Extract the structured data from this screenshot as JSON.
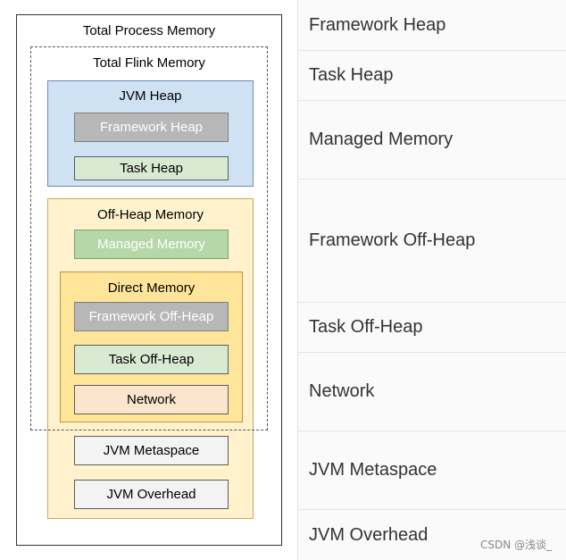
{
  "diagram": {
    "total_process_memory": "Total Process Memory",
    "total_flink_memory": "Total Flink Memory",
    "jvm_heap": {
      "label": "JVM Heap",
      "framework_heap": "Framework Heap",
      "task_heap": "Task Heap"
    },
    "off_heap": {
      "label": "Off-Heap Memory",
      "managed_memory": "Managed Memory",
      "direct": {
        "label": "Direct Memory",
        "framework_off_heap": "Framework Off-Heap",
        "task_off_heap": "Task Off-Heap",
        "network": "Network"
      },
      "jvm_metaspace": "JVM Metaspace",
      "jvm_overhead": "JVM Overhead"
    },
    "colors": {
      "jvm_heap_bg": "#cfe2f3",
      "off_heap_bg": "#fff2cc",
      "direct_memory_bg": "#ffe599",
      "framework_block": "#b7b7b7",
      "task_block": "#d9ead3",
      "managed_block": "#b6d7a8",
      "network_block": "#fce5cd",
      "jvm_misc_block": "#f3f3f3"
    }
  },
  "table": {
    "rows": [
      "Framework Heap",
      "Task Heap",
      "Managed Memory",
      "Framework Off-Heap",
      "Task Off-Heap",
      "Network",
      "JVM Metaspace",
      "JVM Overhead"
    ]
  },
  "watermark": "CSDN @浅谈_"
}
